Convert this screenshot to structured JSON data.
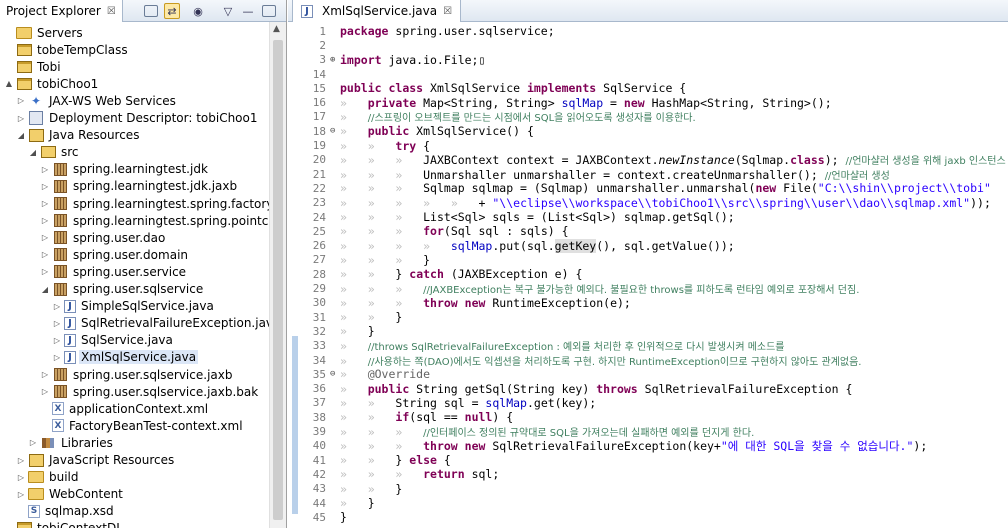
{
  "explorer": {
    "tab_title": "Project Explorer",
    "tab_close": "☒",
    "tree": [
      {
        "label": "Servers",
        "icon": "folder-icon",
        "twisty": "",
        "indent": 0
      },
      {
        "label": "tobeTempClass",
        "icon": "project-icon",
        "twisty": "",
        "indent": 0
      },
      {
        "label": "Tobi",
        "icon": "project-icon",
        "twisty": "",
        "indent": 0
      },
      {
        "label": "tobiChoo1",
        "icon": "project-icon",
        "twisty": "▲",
        "indent": 0
      },
      {
        "label": "JAX-WS Web Services",
        "icon": "web-services-icon",
        "twisty": "▷",
        "indent": 1
      },
      {
        "label": "Deployment Descriptor: tobiChoo1",
        "icon": "descriptor-icon",
        "twisty": "▷",
        "indent": 1
      },
      {
        "label": "Java Resources",
        "icon": "java-resources-icon",
        "twisty": "◢",
        "indent": 1
      },
      {
        "label": "src",
        "icon": "source-folder-icon",
        "twisty": "◢",
        "indent": 2
      },
      {
        "label": "spring.learningtest.jdk",
        "icon": "package-icon",
        "twisty": "▷",
        "indent": 3
      },
      {
        "label": "spring.learningtest.jdk.jaxb",
        "icon": "package-icon",
        "twisty": "▷",
        "indent": 3
      },
      {
        "label": "spring.learningtest.spring.factorybean",
        "icon": "package-icon",
        "twisty": "▷",
        "indent": 3
      },
      {
        "label": "spring.learningtest.spring.pointcut",
        "icon": "package-icon",
        "twisty": "▷",
        "indent": 3
      },
      {
        "label": "spring.user.dao",
        "icon": "package-icon",
        "twisty": "▷",
        "indent": 3
      },
      {
        "label": "spring.user.domain",
        "icon": "package-icon",
        "twisty": "▷",
        "indent": 3
      },
      {
        "label": "spring.user.service",
        "icon": "package-icon",
        "twisty": "▷",
        "indent": 3
      },
      {
        "label": "spring.user.sqlservice",
        "icon": "package-icon",
        "twisty": "◢",
        "indent": 3
      },
      {
        "label": "SimpleSqlService.java",
        "icon": "java-file-icon",
        "twisty": "▷",
        "indent": 4
      },
      {
        "label": "SqlRetrievalFailureException.java",
        "icon": "java-file-icon",
        "twisty": "▷",
        "indent": 4
      },
      {
        "label": "SqlService.java",
        "icon": "java-file-icon",
        "twisty": "▷",
        "indent": 4
      },
      {
        "label": "XmlSqlService.java",
        "icon": "java-file-icon",
        "twisty": "▷",
        "indent": 4,
        "selected": true
      },
      {
        "label": "spring.user.sqlservice.jaxb",
        "icon": "package-icon",
        "twisty": "▷",
        "indent": 3
      },
      {
        "label": "spring.user.sqlservice.jaxb.bak",
        "icon": "package-icon",
        "twisty": "▷",
        "indent": 3
      },
      {
        "label": "applicationContext.xml",
        "icon": "xml-file-icon",
        "twisty": "",
        "indent": 3
      },
      {
        "label": "FactoryBeanTest-context.xml",
        "icon": "xml-file-icon",
        "twisty": "",
        "indent": 3
      },
      {
        "label": "Libraries",
        "icon": "library-icon",
        "twisty": "▷",
        "indent": 2
      },
      {
        "label": "JavaScript Resources",
        "icon": "javascript-resources-icon",
        "twisty": "▷",
        "indent": 1
      },
      {
        "label": "build",
        "icon": "folder-icon",
        "twisty": "▷",
        "indent": 1
      },
      {
        "label": "WebContent",
        "icon": "folder-icon",
        "twisty": "▷",
        "indent": 1
      },
      {
        "label": "sqlmap.xsd",
        "icon": "xsd-file-icon",
        "twisty": "",
        "indent": 1
      },
      {
        "label": "tobiContextDI",
        "icon": "project-icon",
        "twisty": "",
        "indent": 0
      }
    ]
  },
  "editor": {
    "tab_title": "XmlSqlService.java",
    "tab_close": "☒",
    "lines": [
      {
        "n": "1",
        "fold": "",
        "code": "package spring.user.sqlservice;"
      },
      {
        "n": "2",
        "fold": "",
        "code": ""
      },
      {
        "n": "3",
        "fold": "⊕",
        "code": "import java.io.File;▯"
      },
      {
        "n": "14",
        "fold": "",
        "code": ""
      },
      {
        "n": "15",
        "fold": "",
        "code": "public class XmlSqlService implements SqlService {"
      },
      {
        "n": "16",
        "fold": "",
        "code": "    private Map<String, String> sqlMap = new HashMap<String, String>();"
      },
      {
        "n": "17",
        "fold": "",
        "code": "    //스프링이 오브젝트를 만드는 시점에서 SQL을 읽어오도록 생성자를 이용한다."
      },
      {
        "n": "18",
        "fold": "⊖",
        "code": "    public XmlSqlService() {"
      },
      {
        "n": "19",
        "fold": "",
        "code": "        try {"
      },
      {
        "n": "20",
        "fold": "",
        "code": "            JAXBContext context = JAXBContext.newInstance(Sqlmap.class); //언마샬러 생성을 위해 jaxb 인스턴스 획득"
      },
      {
        "n": "21",
        "fold": "",
        "code": "            Unmarshaller unmarshaller = context.createUnmarshaller(); //언마샬러 생성"
      },
      {
        "n": "22",
        "fold": "",
        "code": "            Sqlmap sqlmap = (Sqlmap) unmarshaller.unmarshal(new File(\"C:\\\\shin\\\\project\\\\tobi\""
      },
      {
        "n": "23",
        "fold": "",
        "code": "                    + \"\\\\eclipse\\\\workspace\\\\tobiChoo1\\\\src\\\\spring\\\\user\\\\dao\\\\sqlmap.xml\"));"
      },
      {
        "n": "24",
        "fold": "",
        "code": "            List<Sql> sqls = (List<Sql>) sqlmap.getSql();"
      },
      {
        "n": "25",
        "fold": "",
        "code": "            for(Sql sql : sqls) {"
      },
      {
        "n": "26",
        "fold": "",
        "code": "                sqlMap.put(sql.getKey(), sql.getValue());"
      },
      {
        "n": "27",
        "fold": "",
        "code": "            }"
      },
      {
        "n": "28",
        "fold": "",
        "code": "        } catch (JAXBException e) {"
      },
      {
        "n": "29",
        "fold": "",
        "code": "            //JAXBException는 복구 불가능한 예외다. 불필요한 throws를 피하도록 런타임 예외로 포장해서 던짐."
      },
      {
        "n": "30",
        "fold": "",
        "code": "            throw new RuntimeException(e);"
      },
      {
        "n": "31",
        "fold": "",
        "code": "        }"
      },
      {
        "n": "32",
        "fold": "",
        "code": "    }"
      },
      {
        "n": "33",
        "fold": "",
        "code": "    //throws SqlRetrievalFailureException : 예외를 처리한 후 인위적으로 다시 발생시켜 메소드를"
      },
      {
        "n": "34",
        "fold": "",
        "code": "    //사용하는 쪽(DAO)에서도 익셉션을 처리하도록 구현. 하지만 RuntimeException이므로 구현하지 않아도 관계없음."
      },
      {
        "n": "35",
        "fold": "⊖",
        "code": "    @Override"
      },
      {
        "n": "36",
        "fold": "",
        "code": "    public String getSql(String key) throws SqlRetrievalFailureException {"
      },
      {
        "n": "37",
        "fold": "",
        "code": "        String sql = sqlMap.get(key);"
      },
      {
        "n": "38",
        "fold": "",
        "code": "        if(sql == null) {"
      },
      {
        "n": "39",
        "fold": "",
        "code": "            //인터페이스 정의된 규약대로 SQL을 가져오는데 실패하면 예외를 던지게 한다."
      },
      {
        "n": "40",
        "fold": "",
        "code": "            throw new SqlRetrievalFailureException(key+\"에 대한 SQL을 찾을 수 없습니다.\");"
      },
      {
        "n": "41",
        "fold": "",
        "code": "        } else {"
      },
      {
        "n": "42",
        "fold": "",
        "code": "            return sql;"
      },
      {
        "n": "43",
        "fold": "",
        "code": "        }"
      },
      {
        "n": "44",
        "fold": "",
        "code": "    }"
      },
      {
        "n": "45",
        "fold": "",
        "code": "}"
      }
    ]
  }
}
